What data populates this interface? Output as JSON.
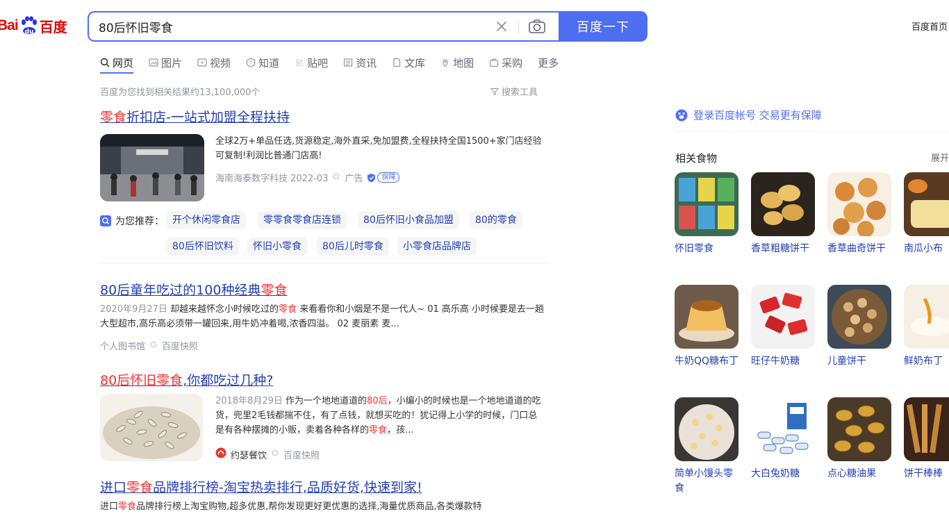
{
  "logo": {
    "bai": "Bai",
    "du": "百度"
  },
  "search": {
    "query": "80后怀旧零食",
    "button": "百度一下"
  },
  "topbar": {
    "home": "百度首页"
  },
  "tabs": [
    {
      "label": "网页",
      "icon": "search-icon"
    },
    {
      "label": "图片",
      "icon": "image-icon"
    },
    {
      "label": "视频",
      "icon": "video-icon"
    },
    {
      "label": "知道",
      "icon": "question-icon"
    },
    {
      "label": "贴吧",
      "icon": "tieba-icon"
    },
    {
      "label": "资讯",
      "icon": "news-icon"
    },
    {
      "label": "文库",
      "icon": "doc-icon"
    },
    {
      "label": "地图",
      "icon": "map-icon"
    },
    {
      "label": "采购",
      "icon": "purchase-icon"
    },
    {
      "label": "更多",
      "icon": ""
    }
  ],
  "meta": {
    "count": "百度为您找到相关结果约13,100,000个",
    "tools": "搜索工具"
  },
  "results": [
    {
      "title_hl": "零食",
      "title_rest": "折扣店-一站式加盟全程扶持",
      "snippet": "全球2万+单品任选,货源稳定,海外直采,免加盟费,全程扶持全国1500+家门店经验可复制!利润比普通门店高!",
      "source": "海南海泰数字科技 2022-03",
      "ad": "广告",
      "bao": "保障"
    },
    {
      "title_a": "80后童年吃过的100种经典",
      "title_hl": "零食",
      "date": "2020年9月27日",
      "snip_a": " 却越来越怀念小时候吃过的",
      "snip_hl": "零食",
      "snip_b": " 来看看你和小烟是不是一代人~ 01 高乐高 小时候要是去一趟大型超市,高乐高必须带一罐回来,用牛奶冲着喝,浓香四溢。 02 麦丽素 麦...",
      "source": "个人图书馆",
      "kuaizhao": "百度快照"
    },
    {
      "title_hl": "80后怀旧零食",
      "title_rest": ",你都吃过几种?",
      "date": "2018年8月29日",
      "snip_a": " 作为一个地地道道的",
      "snip_hl": "80后",
      "snip_b": "，小编小的时候也是一个地地道道的吃货，兜里2毛钱都揣不住，有了点钱，就想买吃的！犹记得上小学的时候，门口总是有各种摆摊的小贩，卖着各种各样的",
      "snip_hl2": "零食",
      "snip_c": "，孩...",
      "source": "约瑟餐饮",
      "kuaizhao": "百度快照"
    },
    {
      "title_a": "进口",
      "title_hl": "零食",
      "title_rest": "品牌排行榜-淘宝热卖排行,品质好货,快速到家!",
      "snip_a": "进口",
      "snip_hl": "零食",
      "snip_b": "品牌排行榜上淘宝购物,超多优惠,帮你发现更好更优惠的选择,海量优质商品,各类爆款特"
    }
  ],
  "recommend": {
    "label": "为您推荐：",
    "chips": [
      "开个休闲零食店",
      "零零食零食店连锁",
      "80后怀旧小食品加盟",
      "80的零食",
      "80后怀旧饮料",
      "怀旧小零食",
      "80后儿时零食",
      "小零食店品牌店"
    ]
  },
  "right": {
    "login": "登录百度帐号 交易更有保障",
    "related_title": "相关食物",
    "expand": "展开",
    "foods": [
      {
        "name": "怀旧零食"
      },
      {
        "name": "香草粗糖饼干"
      },
      {
        "name": "香草曲奇饼干"
      },
      {
        "name": "南瓜小布"
      },
      {
        "name": "牛奶QQ糖布丁"
      },
      {
        "name": "旺仔牛奶糖"
      },
      {
        "name": "儿童饼干"
      },
      {
        "name": "鲜奶布丁"
      },
      {
        "name": "简单小馒头零食"
      },
      {
        "name": "大白兔奶糖"
      },
      {
        "name": "点心糖油果"
      },
      {
        "name": "饼干棒棒"
      }
    ]
  },
  "colors": {
    "accent": "#4e6ef2",
    "link": "#2440b3",
    "highlight": "#f73131",
    "muted": "#9195a3",
    "logo_red": "#e10602"
  }
}
